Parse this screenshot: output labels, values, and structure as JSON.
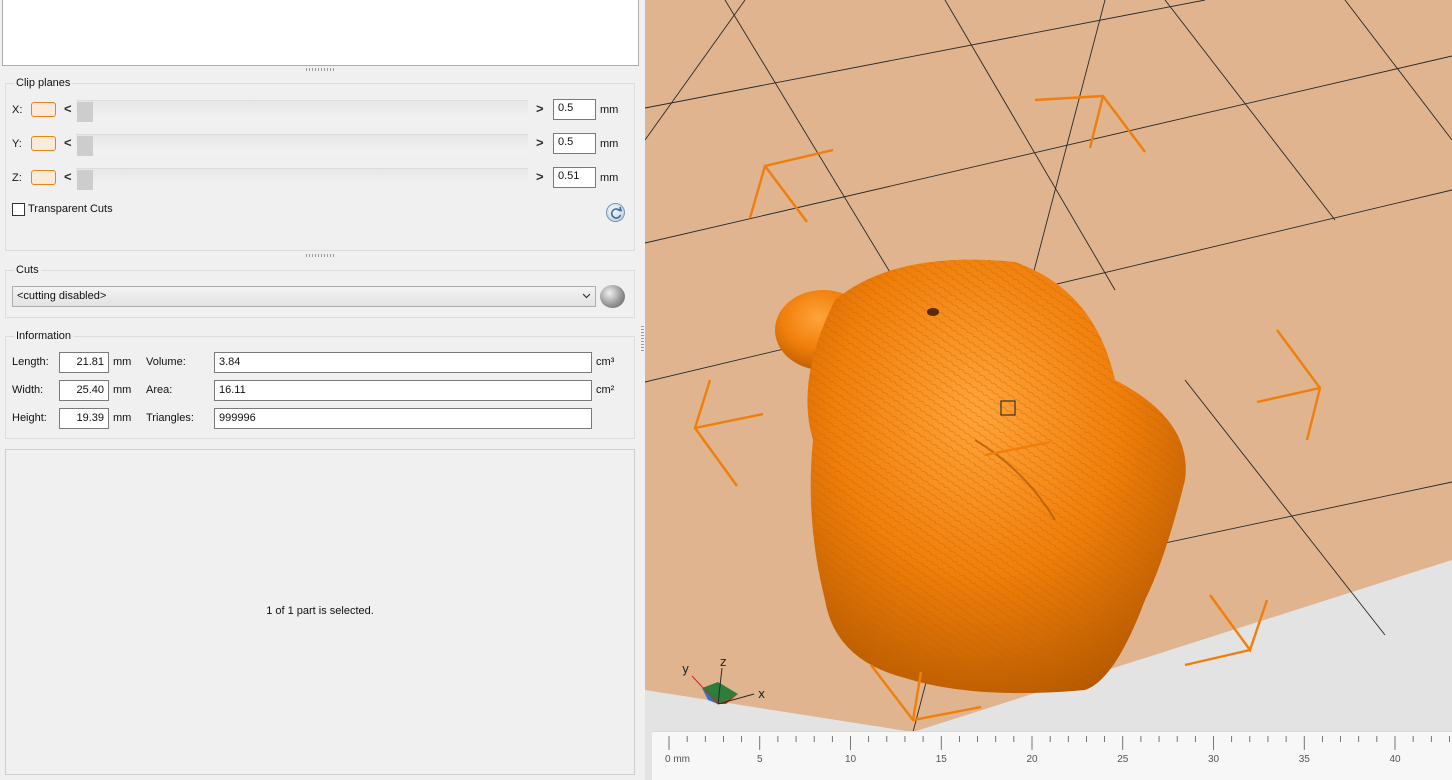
{
  "clip_planes": {
    "title": "Clip planes",
    "rows": [
      {
        "axis": "X:",
        "value": "0.5",
        "unit": "mm"
      },
      {
        "axis": "Y:",
        "value": "0.5",
        "unit": "mm"
      },
      {
        "axis": "Z:",
        "value": "0.51",
        "unit": "mm"
      }
    ],
    "prev_arrow": "<",
    "next_arrow": ">",
    "transparent_cuts_label": "Transparent Cuts"
  },
  "cuts": {
    "title": "Cuts",
    "selected": "<cutting disabled>"
  },
  "information": {
    "title": "Information",
    "length_label": "Length:",
    "length_value": "21.81",
    "width_label": "Width:",
    "width_value": "25.40",
    "height_label": "Height:",
    "height_value": "19.39",
    "dim_unit": "mm",
    "volume_label": "Volume:",
    "volume_value": "3.84",
    "volume_unit": "cm³",
    "area_label": "Area:",
    "area_value": "16.11",
    "area_unit": "cm²",
    "triangles_label": "Triangles:",
    "triangles_value": "999996"
  },
  "status": "1 of 1 part is selected.",
  "axis_labels": {
    "x": "x",
    "y": "y",
    "z": "z"
  },
  "ruler": {
    "labels": [
      "0 mm",
      "5",
      "10",
      "15",
      "20",
      "25",
      "30",
      "35",
      "40"
    ]
  },
  "colors": {
    "accent": "#e8841a",
    "build_plate": "#dfb48e",
    "model": "#f07e0a",
    "background": "#e3e3e3"
  }
}
